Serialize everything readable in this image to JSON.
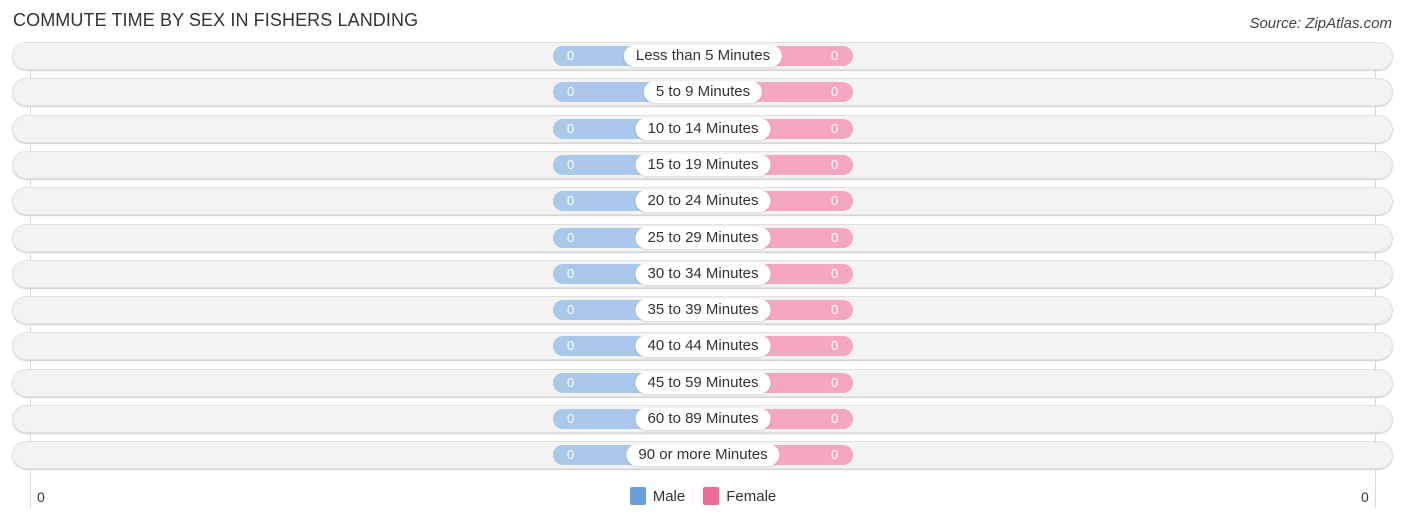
{
  "header": {
    "title": "COMMUTE TIME BY SEX IN FISHERS LANDING",
    "source": "Source: ZipAtlas.com"
  },
  "colors": {
    "male": "#a9c8ea",
    "female": "#f5a7bf",
    "male_legend": "#6b9fdc",
    "female_legend": "#f06a98"
  },
  "chart_data": {
    "type": "bar",
    "orientation": "horizontal-diverging",
    "title": "COMMUTE TIME BY SEX IN FISHERS LANDING",
    "categories": [
      "Less than 5 Minutes",
      "5 to 9 Minutes",
      "10 to 14 Minutes",
      "15 to 19 Minutes",
      "20 to 24 Minutes",
      "25 to 29 Minutes",
      "30 to 34 Minutes",
      "35 to 39 Minutes",
      "40 to 44 Minutes",
      "45 to 59 Minutes",
      "60 to 89 Minutes",
      "90 or more Minutes"
    ],
    "series": [
      {
        "name": "Male",
        "values": [
          0,
          0,
          0,
          0,
          0,
          0,
          0,
          0,
          0,
          0,
          0,
          0
        ]
      },
      {
        "name": "Female",
        "values": [
          0,
          0,
          0,
          0,
          0,
          0,
          0,
          0,
          0,
          0,
          0,
          0
        ]
      }
    ],
    "x_tick_labels": {
      "left": "0",
      "right": "0"
    },
    "legend": {
      "entries": [
        "Male",
        "Female"
      ],
      "placement": "bottom-center"
    },
    "grid": false
  }
}
